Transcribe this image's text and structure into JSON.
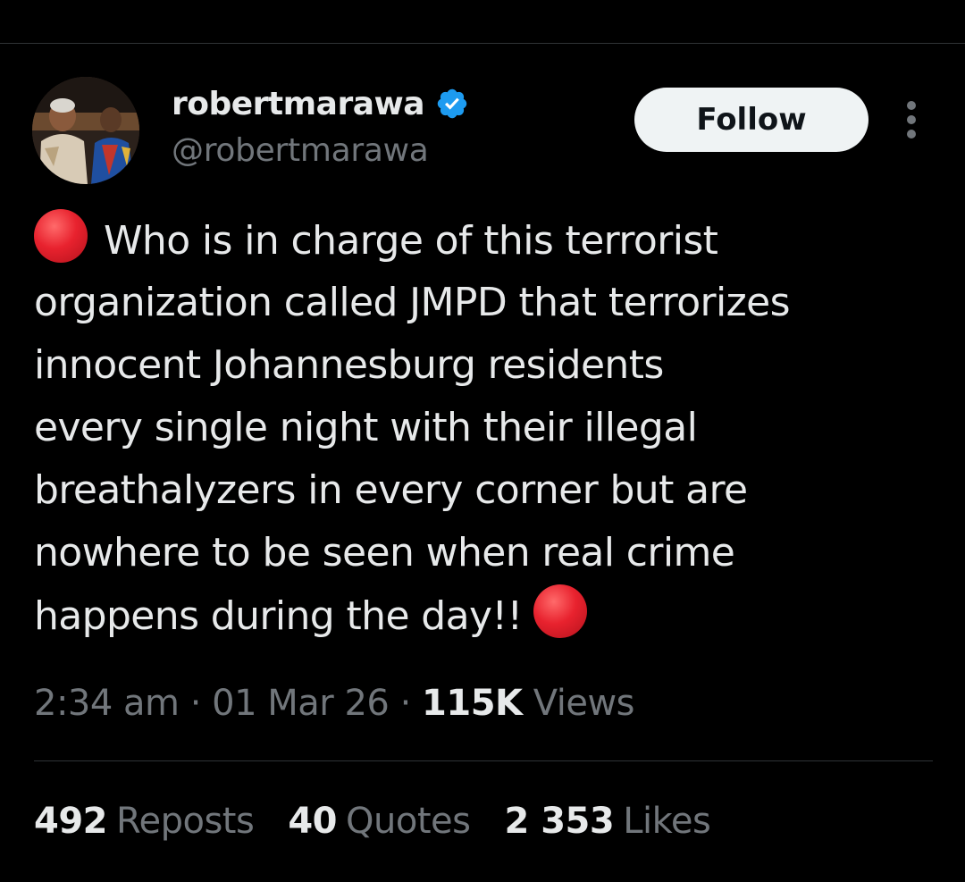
{
  "tweet": {
    "author": {
      "display_name": "robertmarawa",
      "handle": "@robertmarawa",
      "verified": true,
      "avatar_icon": "profile-photo"
    },
    "follow_label": "Follow",
    "more_icon": "more-vertical-icon",
    "text_lines": [
      "Who is in charge of this terrorist",
      "organization called JMPD that terrorizes",
      "innocent Johannesburg residents",
      "every single night with their illegal",
      "breathalyzers in every corner but are",
      "nowhere to be seen when real crime",
      "happens during the day!!"
    ],
    "emoji": "🔴",
    "time": "2:34 am",
    "date": "01 Mar 26",
    "separator": "·",
    "views_count": "115K",
    "views_label": "Views",
    "stats": {
      "reposts_count": "492",
      "reposts_label": "Reposts",
      "quotes_count": "40",
      "quotes_label": "Quotes",
      "likes_count": "2 353",
      "likes_label": "Likes"
    }
  },
  "colors": {
    "background": "#000000",
    "text_primary": "#e7e9ea",
    "text_secondary": "#71767b",
    "divider": "#2f3336",
    "verified_badge": "#1d9bf0",
    "follow_bg": "#eff3f4"
  }
}
